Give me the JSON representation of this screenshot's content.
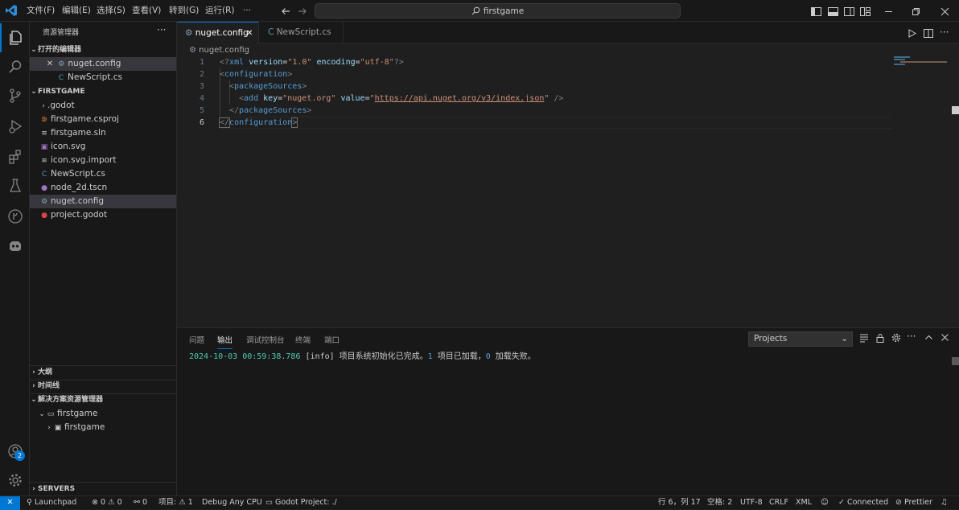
{
  "menu": [
    "文件(F)",
    "编辑(E)",
    "选择(S)",
    "查看(V)",
    "转到(G)",
    "运行(R)",
    "···"
  ],
  "search": {
    "text": "firstgame"
  },
  "sidebar": {
    "title": "资源管理器",
    "open_editors_label": "打开的编辑器",
    "open_editors": [
      "nuget.config",
      "NewScript.cs"
    ],
    "project_label": "FIRSTGAME",
    "files": [
      ".godot",
      "firstgame.csproj",
      "firstgame.sln",
      "icon.svg",
      "icon.svg.import",
      "NewScript.cs",
      "node_2d.tscn",
      "nuget.config",
      "project.godot"
    ],
    "outline_label": "大纲",
    "timeline_label": "时间线",
    "solution_label": "解决方案资源管理器",
    "solution_items": [
      "firstgame",
      "firstgame"
    ],
    "servers_label": "SERVERS"
  },
  "tabs": [
    "nuget.config",
    "NewScript.cs"
  ],
  "breadcrumb": "nuget.config",
  "code": {
    "line_numbers": [
      "1",
      "2",
      "3",
      "4",
      "5",
      "6"
    ],
    "l1": {
      "open": "<?",
      "tag": "xml",
      "a1": " version",
      "eq1": "=",
      "v1": "\"1.0\"",
      "a2": " encoding",
      "eq2": "=",
      "v2": "\"utf-8\"",
      "close": "?>"
    },
    "l2": {
      "open": "<",
      "tag": "configuration",
      "close": ">"
    },
    "l3": {
      "open": "<",
      "tag": "packageSources",
      "close": ">"
    },
    "l4": {
      "open": "<",
      "tag": "add",
      "a1": " key",
      "eq1": "=",
      "v1": "\"nuget.org\"",
      "a2": " value",
      "eq2": "=",
      "v2q": "\"",
      "v2": "https://api.nuget.org/v3/index.json",
      "v2e": "\"",
      "close": " />"
    },
    "l5": {
      "open": "</",
      "tag": "packageSources",
      "close": ">"
    },
    "l6": {
      "open": "</",
      "tag": "configuration",
      "close": ">"
    }
  },
  "panel": {
    "tabs": [
      "问题",
      "输出",
      "调试控制台",
      "终端",
      "端口"
    ],
    "active_tab": "输出",
    "dropdown": "Projects",
    "output": {
      "timestamp": "2024-10-03 00:59:38.786",
      "level": "[info]",
      "m1": " 项目系统初始化已完成。",
      "n1": "1",
      "m2": " 项目已加载，",
      "n2": "0",
      "m3": " 加载失败。"
    }
  },
  "status": {
    "launchpad": "Launchpad",
    "errors": "0",
    "warnings": "0",
    "ports": "0",
    "project": "项目: ⚠ 1",
    "debug": "Debug Any CPU",
    "godot": "Godot Project: ./",
    "position": "行 6，列 17",
    "spaces": "空格: 2",
    "encoding": "UTF-8",
    "eol": "CRLF",
    "language": "XML",
    "connected": "Connected",
    "prettier": "Prettier"
  },
  "badge": "2",
  "colors": {
    "accent": "#0078d4",
    "tag": "#569cd6",
    "attr": "#9cdcfe",
    "string": "#ce9178",
    "number": "#b5cea8"
  }
}
